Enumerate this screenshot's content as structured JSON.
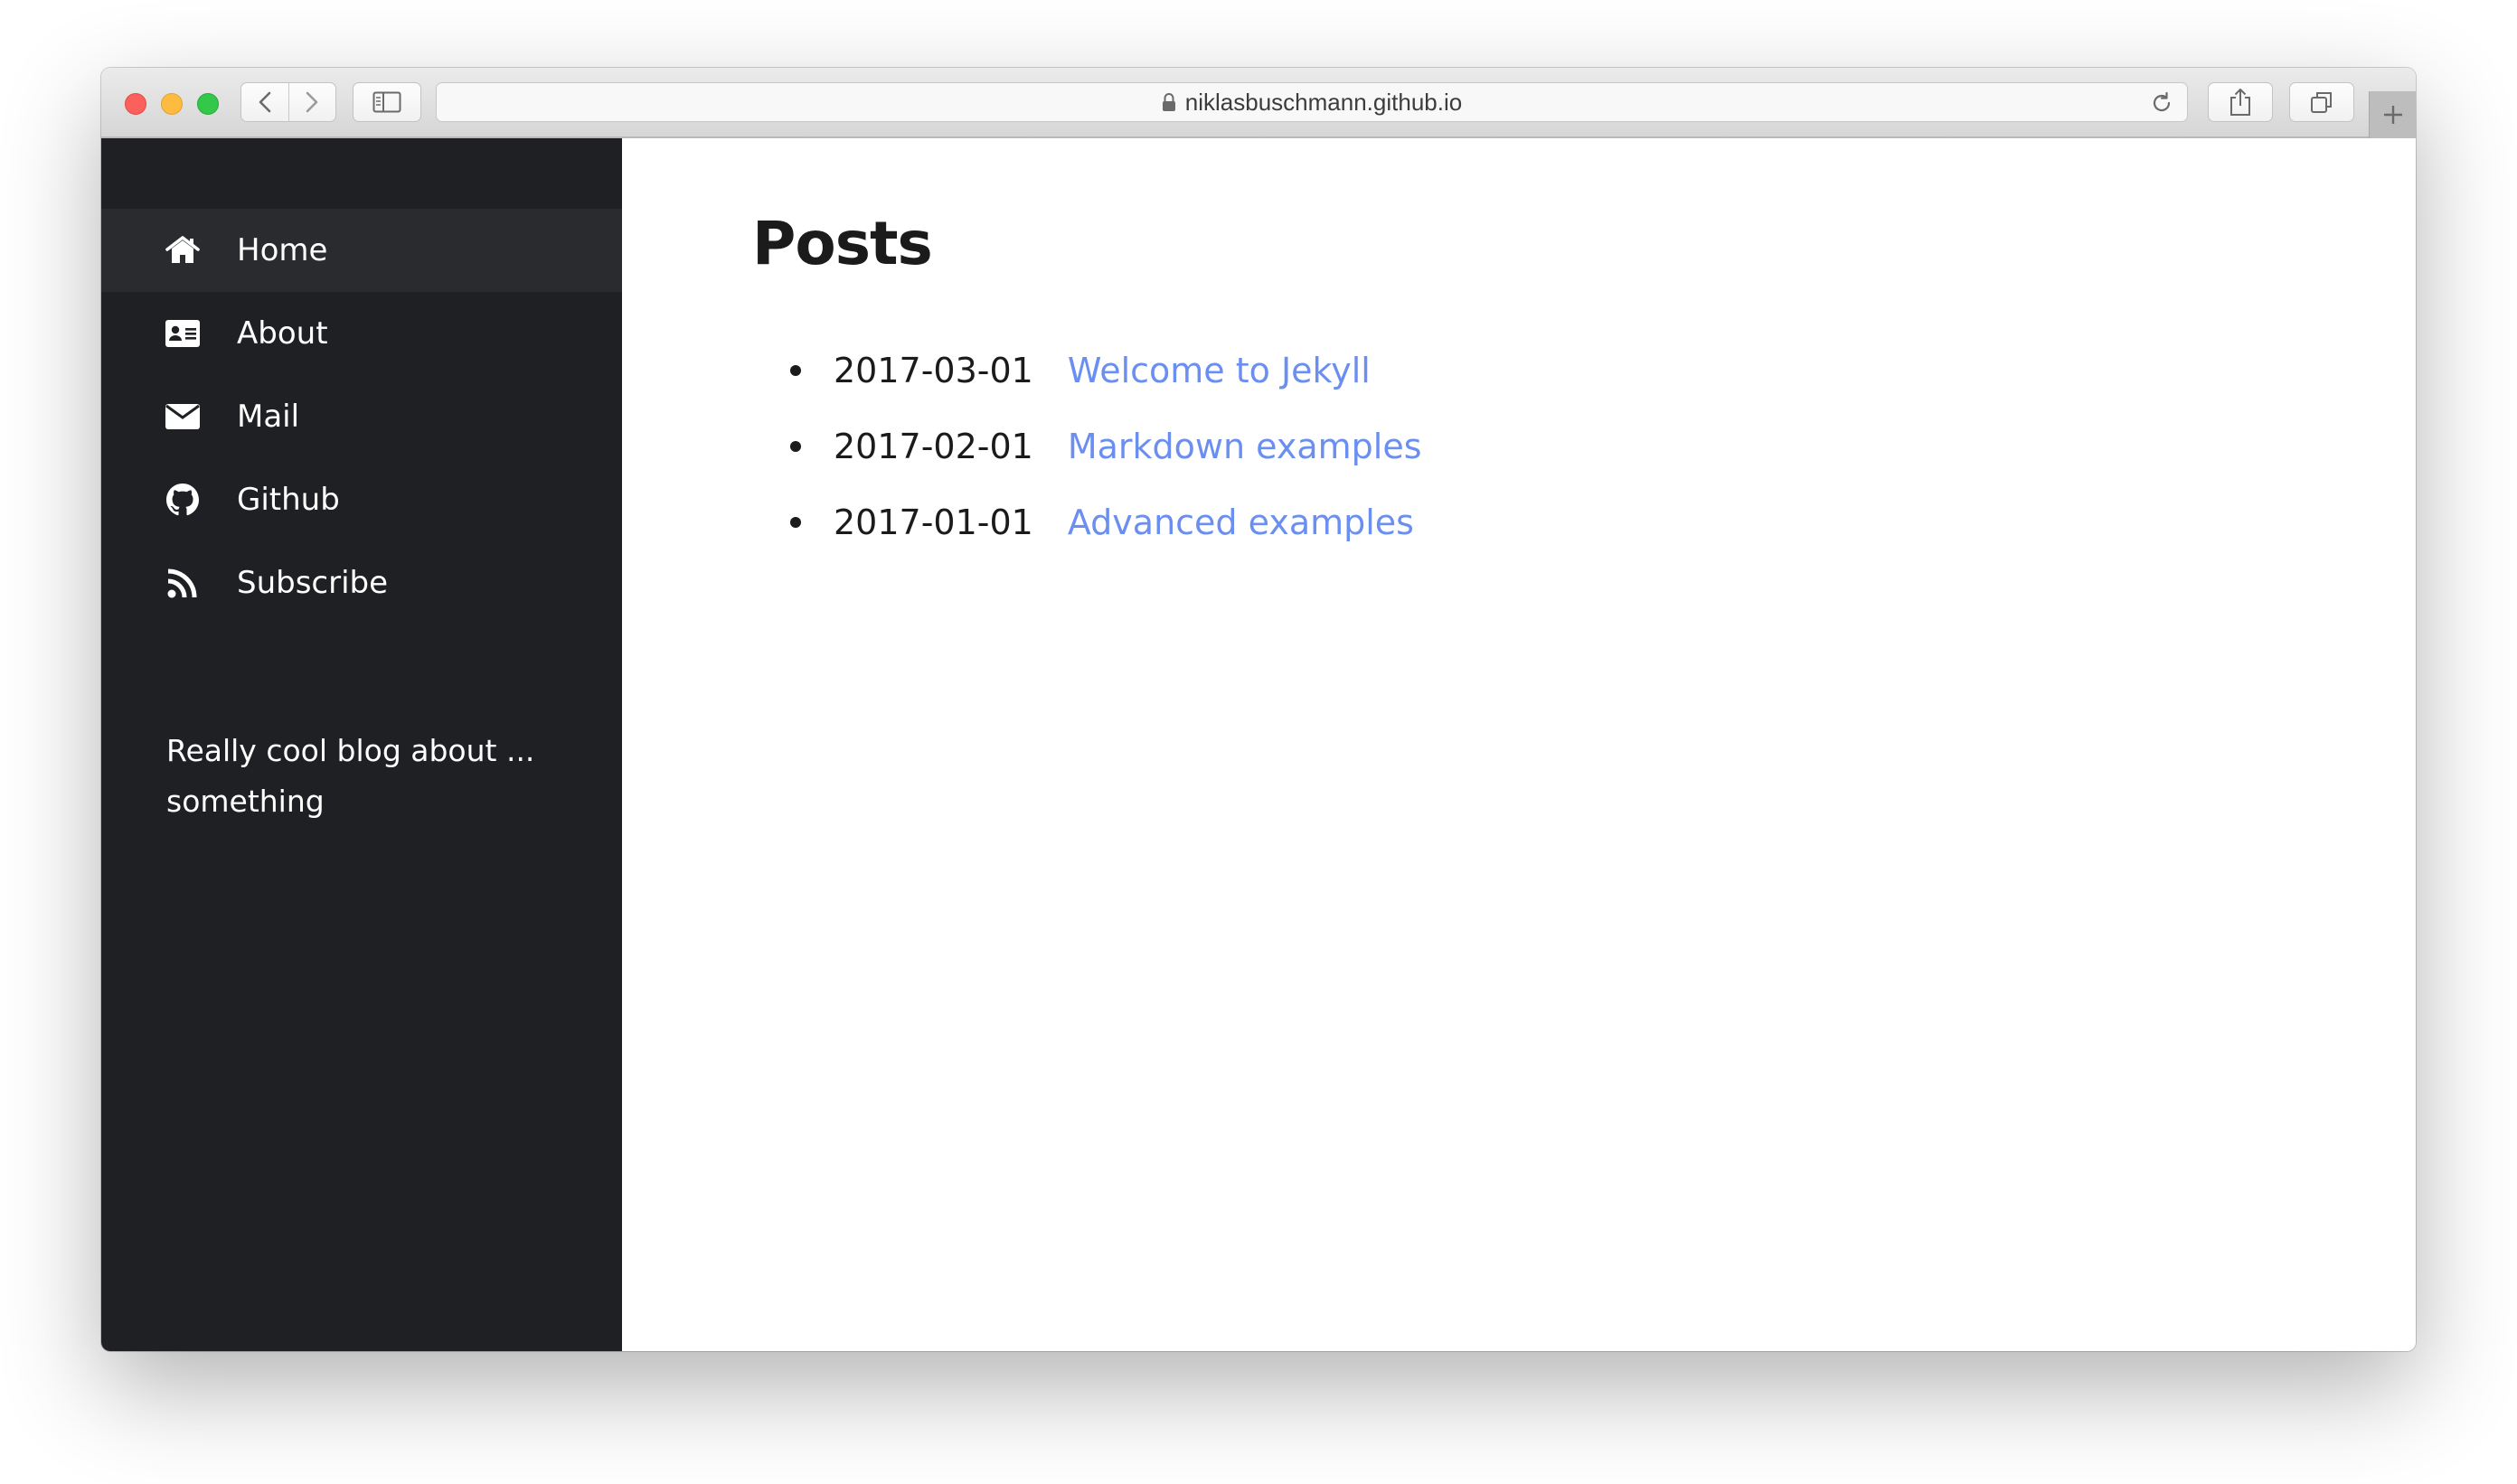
{
  "browser": {
    "url": "niklasbuschmann.github.io"
  },
  "sidebar": {
    "items": [
      {
        "label": "Home",
        "icon": "home-icon",
        "active": true
      },
      {
        "label": "About",
        "icon": "id-card-icon",
        "active": false
      },
      {
        "label": "Mail",
        "icon": "envelope-icon",
        "active": false
      },
      {
        "label": "Github",
        "icon": "github-icon",
        "active": false
      },
      {
        "label": "Subscribe",
        "icon": "rss-icon",
        "active": false
      }
    ],
    "description_line1": "Really cool blog about ...",
    "description_line2": "something"
  },
  "main": {
    "title": "Posts",
    "posts": [
      {
        "date": "2017-03-01",
        "title": "Welcome to Jekyll"
      },
      {
        "date": "2017-02-01",
        "title": "Markdown examples"
      },
      {
        "date": "2017-01-01",
        "title": "Advanced examples"
      }
    ]
  },
  "colors": {
    "sidebar_bg": "#1f2024",
    "sidebar_active_bg": "#2a2b2f",
    "link": "#6b8ff0",
    "text": "#1b1b1b"
  }
}
